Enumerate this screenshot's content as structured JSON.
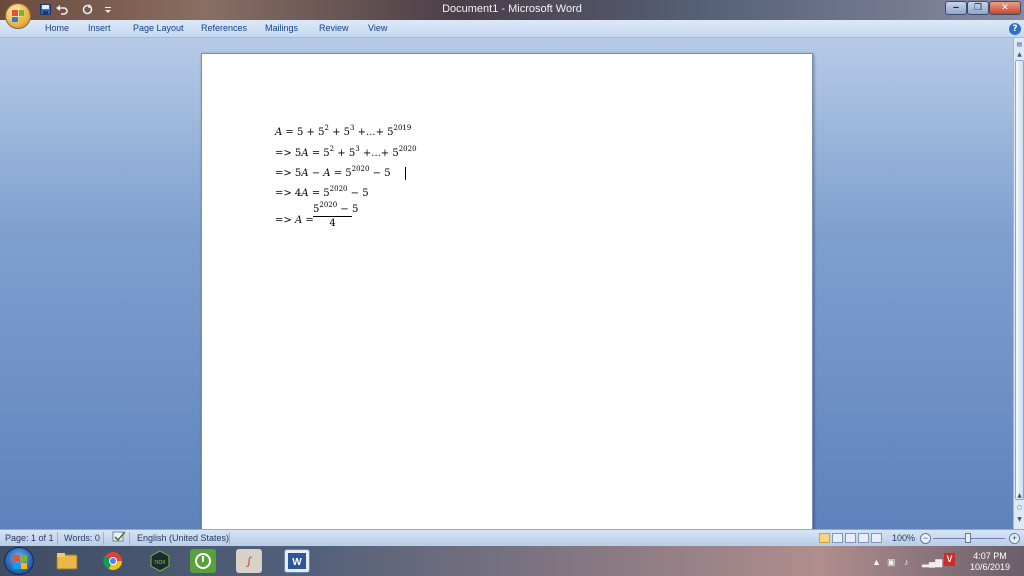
{
  "window": {
    "title": "Document1 - Microsoft Word",
    "minimize": "‒",
    "restore": "❐",
    "close": "✕"
  },
  "quick_access": [
    "save-icon",
    "undo-icon",
    "redo-icon",
    "customize-icon"
  ],
  "ribbon": {
    "tabs": [
      "Home",
      "Insert",
      "Page Layout",
      "References",
      "Mailings",
      "Review",
      "View"
    ],
    "help": "?"
  },
  "document": {
    "lines": {
      "l1": {
        "a": "A",
        "b": " = 5 + 5",
        "e1": "2",
        "c": " + 5",
        "e2": "3",
        "d": " +...+ 5",
        "e3": "2019"
      },
      "l2": {
        "pre": "=> 5",
        "a": "A",
        "b": " = 5",
        "e1": "2",
        "c": " + 5",
        "e2": "3",
        "d": " +...+ 5",
        "e3": "2020"
      },
      "l3": {
        "pre": "=> 5",
        "a": "A",
        "m": " − ",
        "a2": "A",
        "b": " = 5",
        "e1": "2020",
        "c": " − 5"
      },
      "l4": {
        "pre": "=> 4",
        "a": "A",
        "b": " = 5",
        "e1": "2020",
        "c": " − 5"
      },
      "l5": {
        "pre": "=> ",
        "a": "A",
        "b": " =",
        "num_base": "5",
        "num_exp": "2020",
        "num_rest": " − 5",
        "den": "4"
      }
    }
  },
  "status": {
    "page": "Page: 1 of 1",
    "words": "Words: 0",
    "language": "English (United States)",
    "zoom": "100%",
    "zoom_minus": "−",
    "zoom_plus": "+"
  },
  "taskbar": {
    "apps": [
      "windows-explorer-icon",
      "chrome-icon",
      "nox-icon",
      "kaspersky-icon",
      "mathtype-icon",
      "word-icon"
    ],
    "nox_label": "nox",
    "av_label": "V",
    "time": "4:07 PM",
    "date": "10/6/2019"
  },
  "colors": {
    "ribbon_text": "#15428b",
    "page": "#ffffff",
    "doc_background": "#6f93c4"
  }
}
